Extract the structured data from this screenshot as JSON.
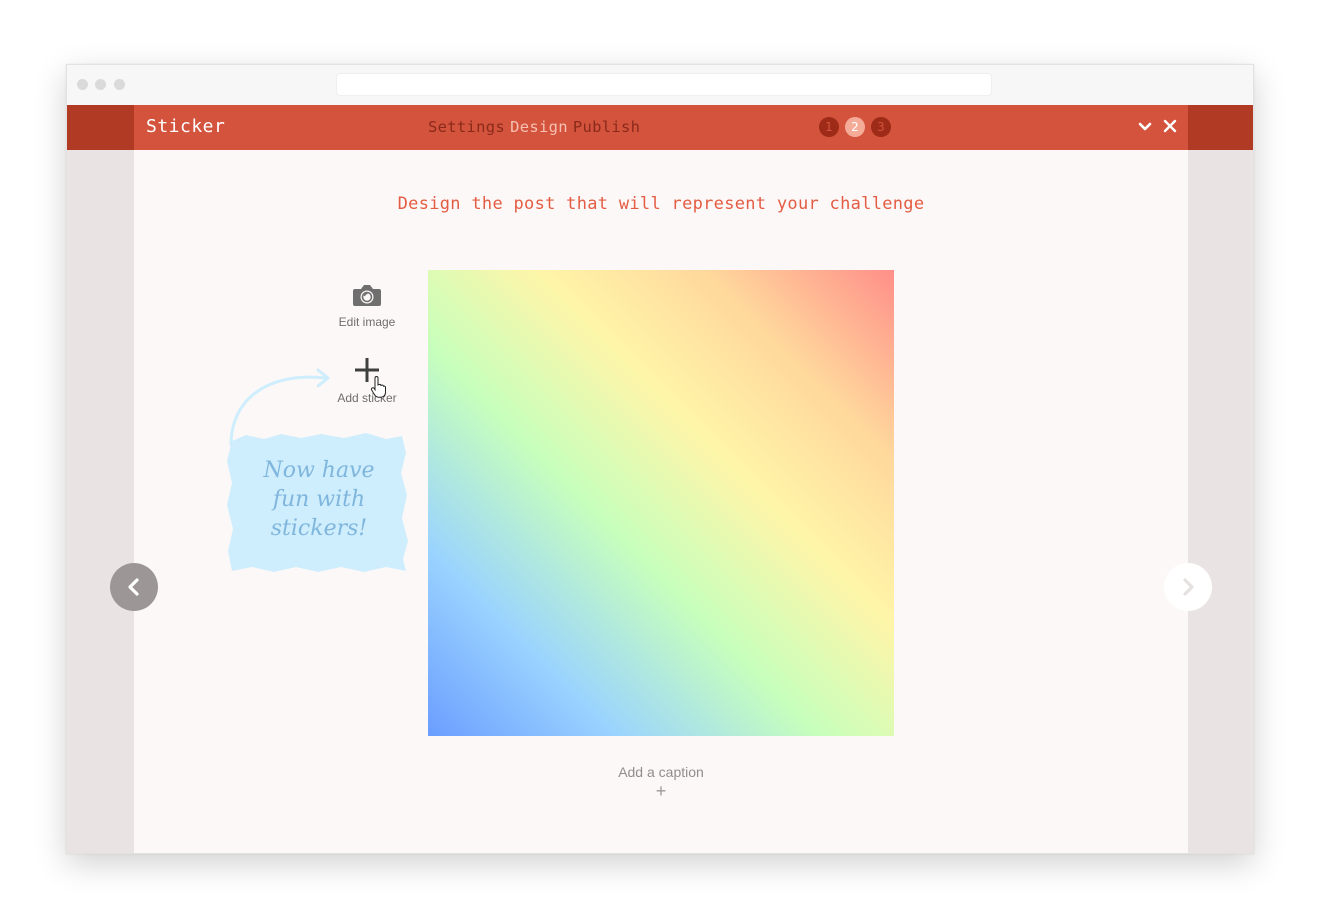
{
  "app": {
    "title": "Sticker",
    "steps": [
      "Settings",
      "Design",
      "Publish"
    ],
    "active_step": 2,
    "step_numbers": [
      "1",
      "2",
      "3"
    ]
  },
  "content": {
    "heading": "Design the post that will represent your challenge",
    "tools": {
      "edit_image": "Edit image",
      "add_sticker": "Add sticker"
    },
    "caption_label": "Add a caption",
    "caption_plus": "+",
    "note_lines": [
      "Now have",
      "fun with",
      "stickers!"
    ]
  },
  "icons": {
    "minimize": "chevron-down-icon",
    "close": "close-icon",
    "camera": "camera-icon",
    "plus": "plus-icon",
    "prev": "chevron-left-icon",
    "next": "chevron-right-icon",
    "cursor": "hand-cursor-icon"
  },
  "colors": {
    "accent": "#d4533d",
    "accent_dark": "#b13a24",
    "heading": "#e45c43",
    "note": "#cfeefd"
  }
}
